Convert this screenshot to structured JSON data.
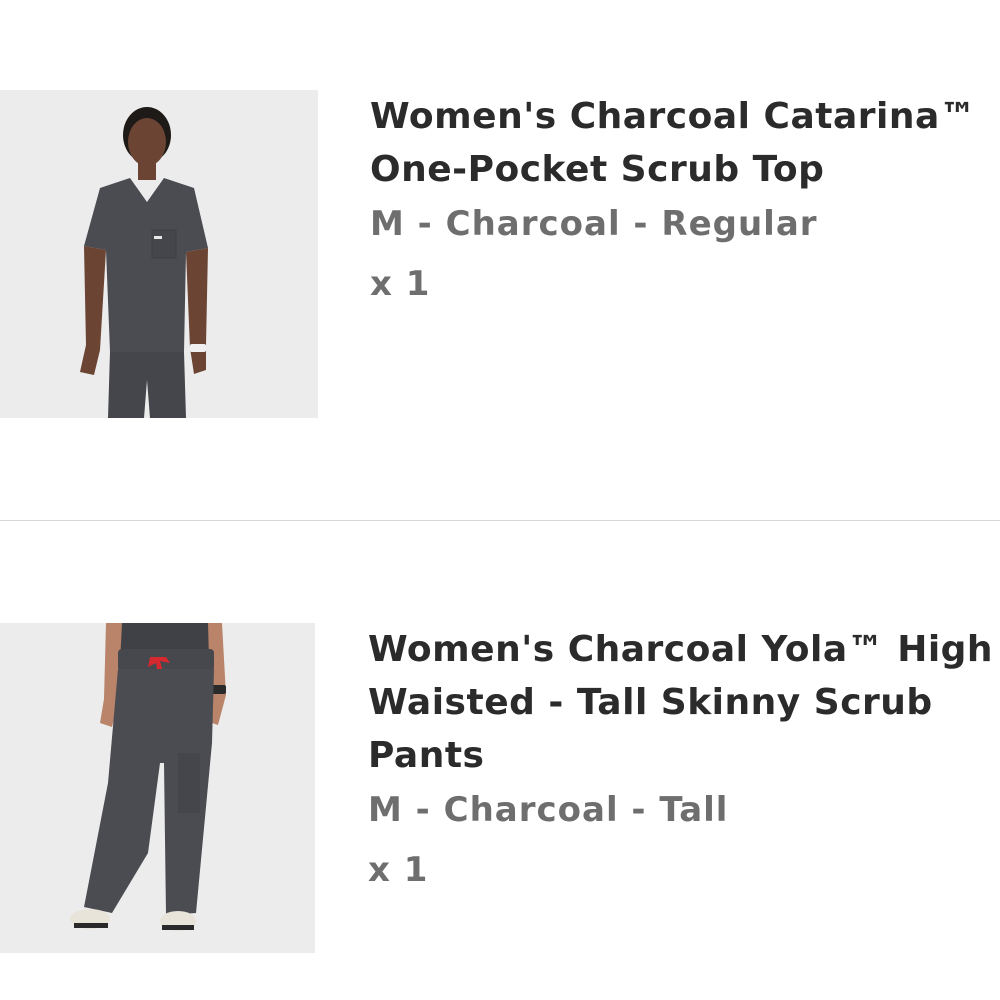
{
  "cart": {
    "items": [
      {
        "title_line1": "Women's Charcoal Catarina™",
        "title_line2": "One-Pocket Scrub Top",
        "title_line3": "",
        "variant": "M - Charcoal - Regular",
        "quantity": "x 1",
        "image_icon": "scrub-top-photo"
      },
      {
        "title_line1": "Women's Charcoal Yola™ High",
        "title_line2": "Waisted - Tall Skinny Scrub",
        "title_line3": "Pants",
        "variant": "M - Charcoal - Tall",
        "quantity": "x 1",
        "image_icon": "scrub-pants-photo"
      }
    ]
  },
  "colors": {
    "background": "#ffffff",
    "title": "#2b2b2b",
    "secondary_text": "#6e6e6e",
    "divider": "#d8d8d8",
    "photo_background": "#ececec",
    "garment": "#4a4c51",
    "drawstring": "#d6282f"
  }
}
